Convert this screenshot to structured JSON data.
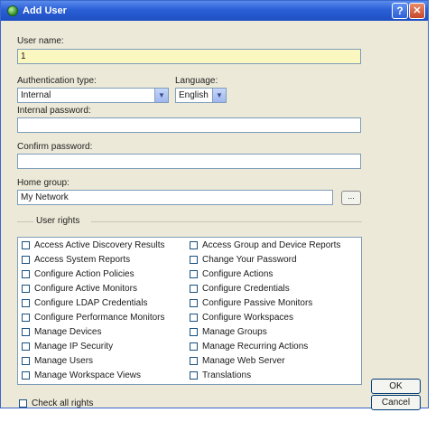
{
  "window": {
    "title": "Add User",
    "help_label": "?",
    "close_label": "✕"
  },
  "user_name": {
    "label": "User name:",
    "value": "1"
  },
  "auth": {
    "label": "Authentication type:",
    "value": "Internal"
  },
  "language": {
    "label": "Language:",
    "value": "English"
  },
  "internal_password": {
    "label": "Internal password:",
    "value": ""
  },
  "confirm_password": {
    "label": "Confirm password:",
    "value": ""
  },
  "home_group": {
    "label": "Home group:",
    "value": "My Network",
    "browse_label": "..."
  },
  "user_rights": {
    "title": "User rights",
    "left": [
      "Access Active Discovery Results",
      "Access System Reports",
      "Configure Action Policies",
      "Configure Active Monitors",
      "Configure LDAP Credentials",
      "Configure Performance Monitors",
      "Manage Devices",
      "Manage IP Security",
      "Manage Users",
      "Manage Workspace Views"
    ],
    "right": [
      "Access Group and Device Reports",
      "Change Your Password",
      "Configure Actions",
      "Configure Credentials",
      "Configure Passive Monitors",
      "Configure Workspaces",
      "Manage Groups",
      "Manage Recurring Actions",
      "Manage Web Server",
      "Translations"
    ]
  },
  "check_all": {
    "label": "Check all rights"
  },
  "buttons": {
    "ok": "OK",
    "cancel": "Cancel"
  }
}
